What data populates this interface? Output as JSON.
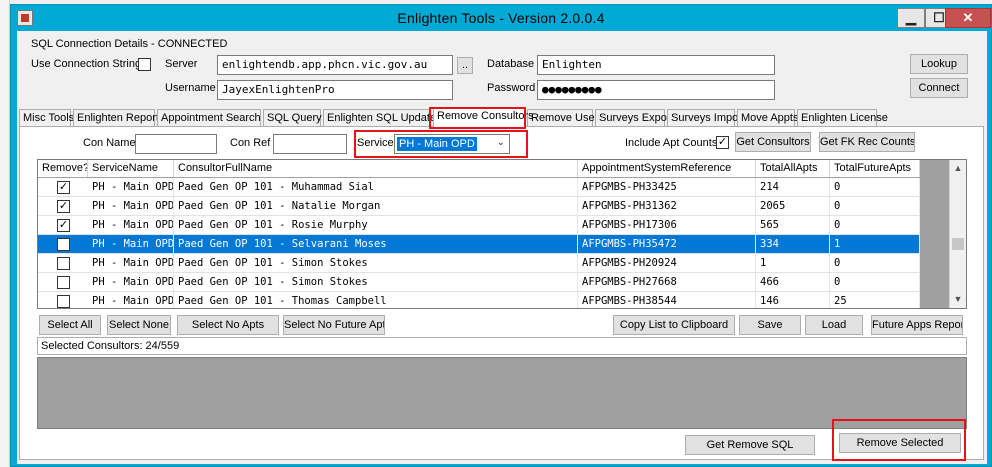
{
  "window": {
    "title": "Enlighten Tools - Version 2.0.0.4",
    "controls": {
      "minimize": "▁",
      "maximize": "☐",
      "close": "✕"
    }
  },
  "connection": {
    "group_label": "SQL Connection Details - CONNECTED",
    "use_conn_string_label": "Use Connection String?",
    "use_conn_string_checked": false,
    "server_label": "Server",
    "server_value": "enlightendb.app.phcn.vic.gov.au",
    "browse_label": "..",
    "username_label": "Username",
    "username_value": "JayexEnlightenPro",
    "database_label": "Database",
    "database_value": "Enlighten",
    "password_label": "Password",
    "password_value": "●●●●●●●●●",
    "lookup_label": "Lookup",
    "connect_label": "Connect"
  },
  "tabs": [
    "Misc Tools",
    "Enlighten Reports",
    "Appointment Search",
    "SQL Query",
    "Enlighten SQL Updates",
    "Remove Consultors",
    "Remove Users",
    "Surveys Export",
    "Surveys Import",
    "Move Appts",
    "Enlighten License"
  ],
  "active_tab": "Remove Consultors",
  "filters": {
    "con_name_label": "Con Name",
    "con_name_value": "",
    "con_ref_label": "Con Ref",
    "con_ref_value": "",
    "service_label": "Service",
    "service_value": "PH - Main OPD",
    "include_apt_counts_label": "Include Apt Counts?",
    "include_apt_counts_checked": true,
    "get_consultors_label": "Get Consultors",
    "get_fk_rec_counts_label": "Get FK Rec Counts"
  },
  "grid": {
    "columns": [
      "Remove?",
      "ServiceName",
      "ConsultorFullName",
      "AppointmentSystemReference",
      "TotalAllApts",
      "TotalFutureApts"
    ],
    "rows": [
      {
        "remove": true,
        "service": "PH - Main OPD",
        "consultor": "Paed Gen OP 101 - Muhammad Sial",
        "ref": "AFPGMBS-PH33425",
        "all": "214",
        "future": "0",
        "selected": false
      },
      {
        "remove": true,
        "service": "PH - Main OPD",
        "consultor": "Paed Gen OP 101 - Natalie Morgan",
        "ref": "AFPGMBS-PH31362",
        "all": "2065",
        "future": "0",
        "selected": false
      },
      {
        "remove": true,
        "service": "PH - Main OPD",
        "consultor": "Paed Gen OP 101 - Rosie Murphy",
        "ref": "AFPGMBS-PH17306",
        "all": "565",
        "future": "0",
        "selected": false
      },
      {
        "remove": false,
        "service": "PH - Main OPD",
        "consultor": "Paed Gen OP 101 - Selvarani Moses",
        "ref": "AFPGMBS-PH35472",
        "all": "334",
        "future": "1",
        "selected": true
      },
      {
        "remove": false,
        "service": "PH - Main OPD",
        "consultor": "Paed Gen OP 101 - Simon Stokes",
        "ref": "AFPGMBS-PH20924",
        "all": "1",
        "future": "0",
        "selected": false
      },
      {
        "remove": false,
        "service": "PH - Main OPD",
        "consultor": "Paed Gen OP 101 - Simon Stokes",
        "ref": "AFPGMBS-PH27668",
        "all": "466",
        "future": "0",
        "selected": false
      },
      {
        "remove": false,
        "service": "PH - Main OPD",
        "consultor": "Paed Gen OP 101 - Thomas Campbell",
        "ref": "AFPGMBS-PH38544",
        "all": "146",
        "future": "25",
        "selected": false
      }
    ]
  },
  "actions": {
    "select_all": "Select All",
    "select_none": "Select None",
    "select_no_apts": "Select No Apts",
    "select_no_future_apts": "Select No Future Apts",
    "copy_list": "Copy List to Clipboard",
    "save": "Save",
    "load": "Load",
    "future_apps_report": "Future Apps Report"
  },
  "status": {
    "selected_consultors": "Selected Consultors: 24/559"
  },
  "bottom": {
    "get_remove_sql": "Get Remove SQL",
    "remove_selected": "Remove Selected"
  },
  "colors": {
    "titlebar": "#00aad4",
    "highlight": "#e8101a",
    "selection": "#0078d7"
  }
}
